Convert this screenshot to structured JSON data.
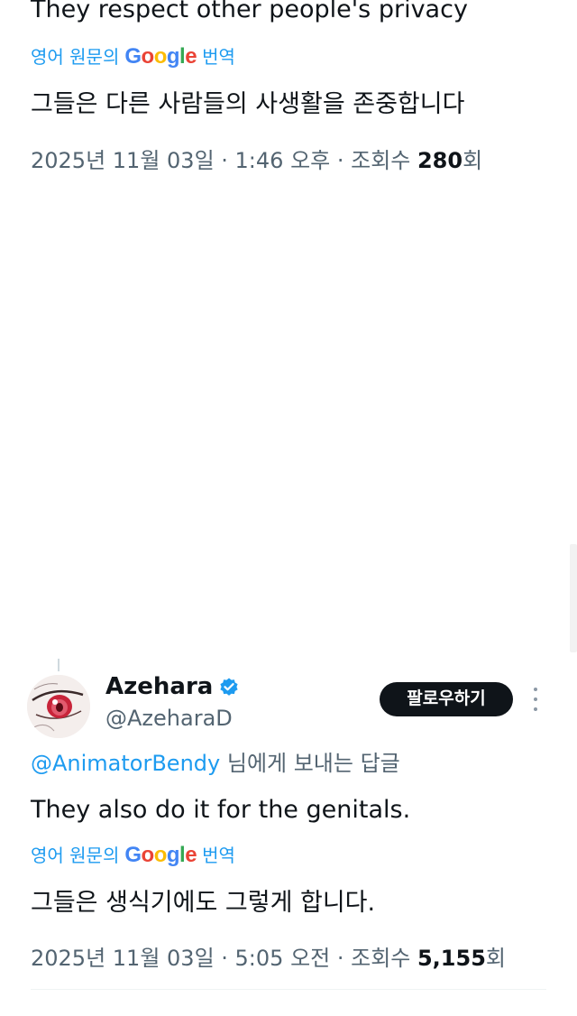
{
  "tweet1": {
    "text": "They respect other people's privacy",
    "translate_prefix": "영어 원문의",
    "translate_suffix": "번역",
    "translated_text": "그들은 다른 사람들의 사생활을 존중합니다",
    "timestamp": "2025년 11월 03일 · 1:46 오후 · 조회수 ",
    "views": "280",
    "views_suffix": "회"
  },
  "tweet2": {
    "display_name": "Azehara",
    "handle": "@AzeharaD",
    "follow_label": "팔로우하기",
    "reply_mention": "@AnimatorBendy",
    "reply_suffix": " 님에게 보내는 답글",
    "text": "They also do it for the genitals.",
    "translate_prefix": "영어 원문의",
    "translate_suffix": "번역",
    "translated_text": "그들은 생식기에도 그렇게 합니다.",
    "timestamp": "2025년 11월 03일 · 5:05 오전 · 조회수 ",
    "views": "5,155",
    "views_suffix": "회"
  },
  "google_logo": {
    "letters": [
      "G",
      "o",
      "o",
      "g",
      "l",
      "e"
    ]
  },
  "icons": {
    "verified": "verified-badge-icon",
    "more": "more-options-icon",
    "avatar": "anime-eye-avatar"
  },
  "colors": {
    "link": "#1d9bf0",
    "text": "#0f1419",
    "muted": "#536471",
    "button_bg": "#0f1419",
    "button_text": "#ffffff"
  }
}
